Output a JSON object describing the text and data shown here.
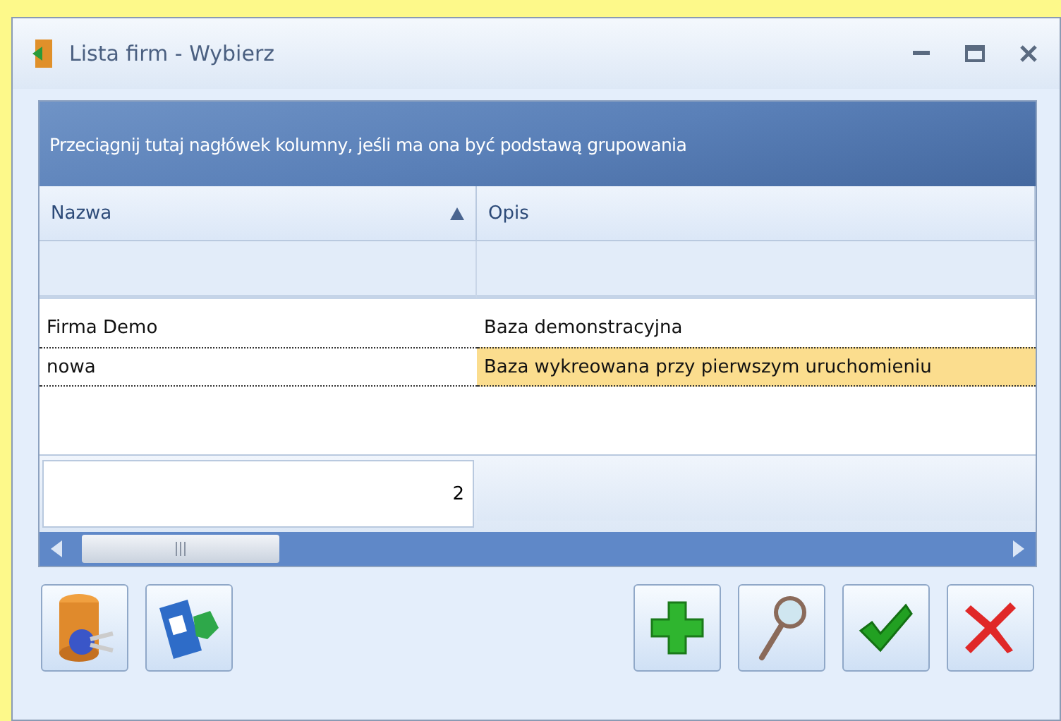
{
  "window": {
    "title": "Lista firm - Wybierz"
  },
  "group_panel": {
    "hint": "Przeciągnij tutaj nagłówek kolumny, jeśli ma ona być podstawą grupowania"
  },
  "table": {
    "columns": [
      {
        "label": "Nazwa",
        "sorted_ascending": true
      },
      {
        "label": "Opis",
        "sorted_ascending": false
      }
    ],
    "rows": [
      {
        "cells": [
          "Firma Demo",
          "Baza demonstracyjna"
        ],
        "selected": false
      },
      {
        "cells": [
          "nowa",
          "Baza wykreowana przy pierwszym uruchomieniu"
        ],
        "selected": true
      }
    ],
    "footer_count": "2"
  },
  "buttons_left": [
    {
      "kind": "database"
    },
    {
      "kind": "save"
    }
  ],
  "buttons_right": [
    {
      "kind": "add"
    },
    {
      "kind": "search"
    },
    {
      "kind": "confirm"
    },
    {
      "kind": "cancel"
    }
  ]
}
